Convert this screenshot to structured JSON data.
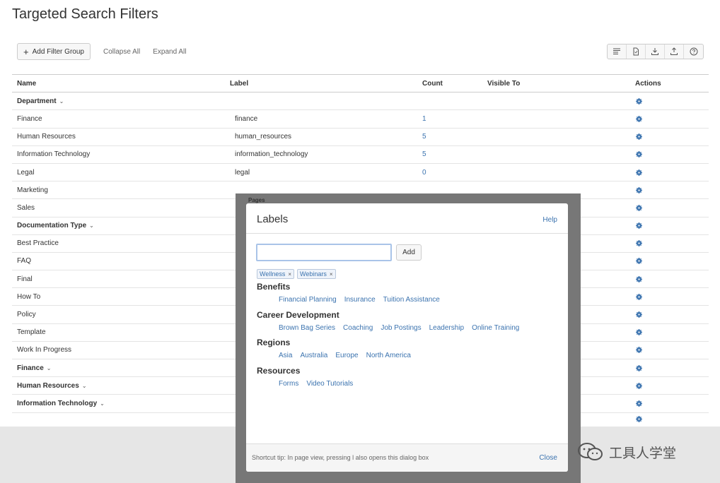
{
  "page": {
    "title": "Targeted Search Filters"
  },
  "toolbar": {
    "add_filter_group": "Add Filter Group",
    "collapse_all": "Collapse All",
    "expand_all": "Expand All",
    "icons": [
      "list-view-icon",
      "document-icon",
      "download-icon",
      "upload-icon",
      "help-icon"
    ]
  },
  "table": {
    "headers": {
      "name": "Name",
      "label": "Label",
      "count": "Count",
      "visible_to": "Visible To",
      "actions": "Actions"
    },
    "rows": [
      {
        "name": "Department",
        "label": "",
        "count": "",
        "group": true
      },
      {
        "name": "Finance",
        "label": "finance",
        "count": "1",
        "group": false
      },
      {
        "name": "Human Resources",
        "label": "human_resources",
        "count": "5",
        "group": false
      },
      {
        "name": "Information Technology",
        "label": "information_technology",
        "count": "5",
        "group": false
      },
      {
        "name": "Legal",
        "label": "legal",
        "count": "0",
        "group": false
      },
      {
        "name": "Marketing",
        "label": "",
        "count": "",
        "group": false
      },
      {
        "name": "Sales",
        "label": "",
        "count": "",
        "group": false
      },
      {
        "name": "Documentation Type",
        "label": "",
        "count": "",
        "group": true
      },
      {
        "name": "Best Practice",
        "label": "",
        "count": "",
        "group": false
      },
      {
        "name": "FAQ",
        "label": "",
        "count": "",
        "group": false
      },
      {
        "name": "Final",
        "label": "",
        "count": "",
        "group": false
      },
      {
        "name": "How To",
        "label": "",
        "count": "",
        "group": false
      },
      {
        "name": "Policy",
        "label": "",
        "count": "",
        "group": false
      },
      {
        "name": "Template",
        "label": "",
        "count": "",
        "group": false
      },
      {
        "name": "Work In Progress",
        "label": "",
        "count": "",
        "group": false
      },
      {
        "name": "Finance",
        "label": "",
        "count": "",
        "group": true
      },
      {
        "name": "Human Resources",
        "label": "",
        "count": "",
        "group": true
      },
      {
        "name": "Information Technology",
        "label": "",
        "count": "",
        "group": true
      }
    ]
  },
  "behind_dialog_text": "Pages",
  "dialog": {
    "title": "Labels",
    "help": "Help",
    "input_value": "",
    "add_button": "Add",
    "selected_tags": [
      "Wellness",
      "Webinars"
    ],
    "categories": [
      {
        "title": "Benefits",
        "items": [
          "Financial Planning",
          "Insurance",
          "Tuition Assistance"
        ]
      },
      {
        "title": "Career Development",
        "items": [
          "Brown Bag Series",
          "Coaching",
          "Job Postings",
          "Leadership",
          "Online Training"
        ]
      },
      {
        "title": "Regions",
        "items": [
          "Asia",
          "Australia",
          "Europe",
          "North America"
        ]
      },
      {
        "title": "Resources",
        "items": [
          "Forms",
          "Video Tutorials"
        ]
      }
    ],
    "footer_tip": "Shortcut tip: In page view, pressing l also opens this dialog box",
    "close": "Close"
  },
  "watermark": {
    "text": "工具人学堂"
  },
  "colors": {
    "link": "#3b73af",
    "gear": "#3b73af",
    "backdrop": "#777777"
  }
}
